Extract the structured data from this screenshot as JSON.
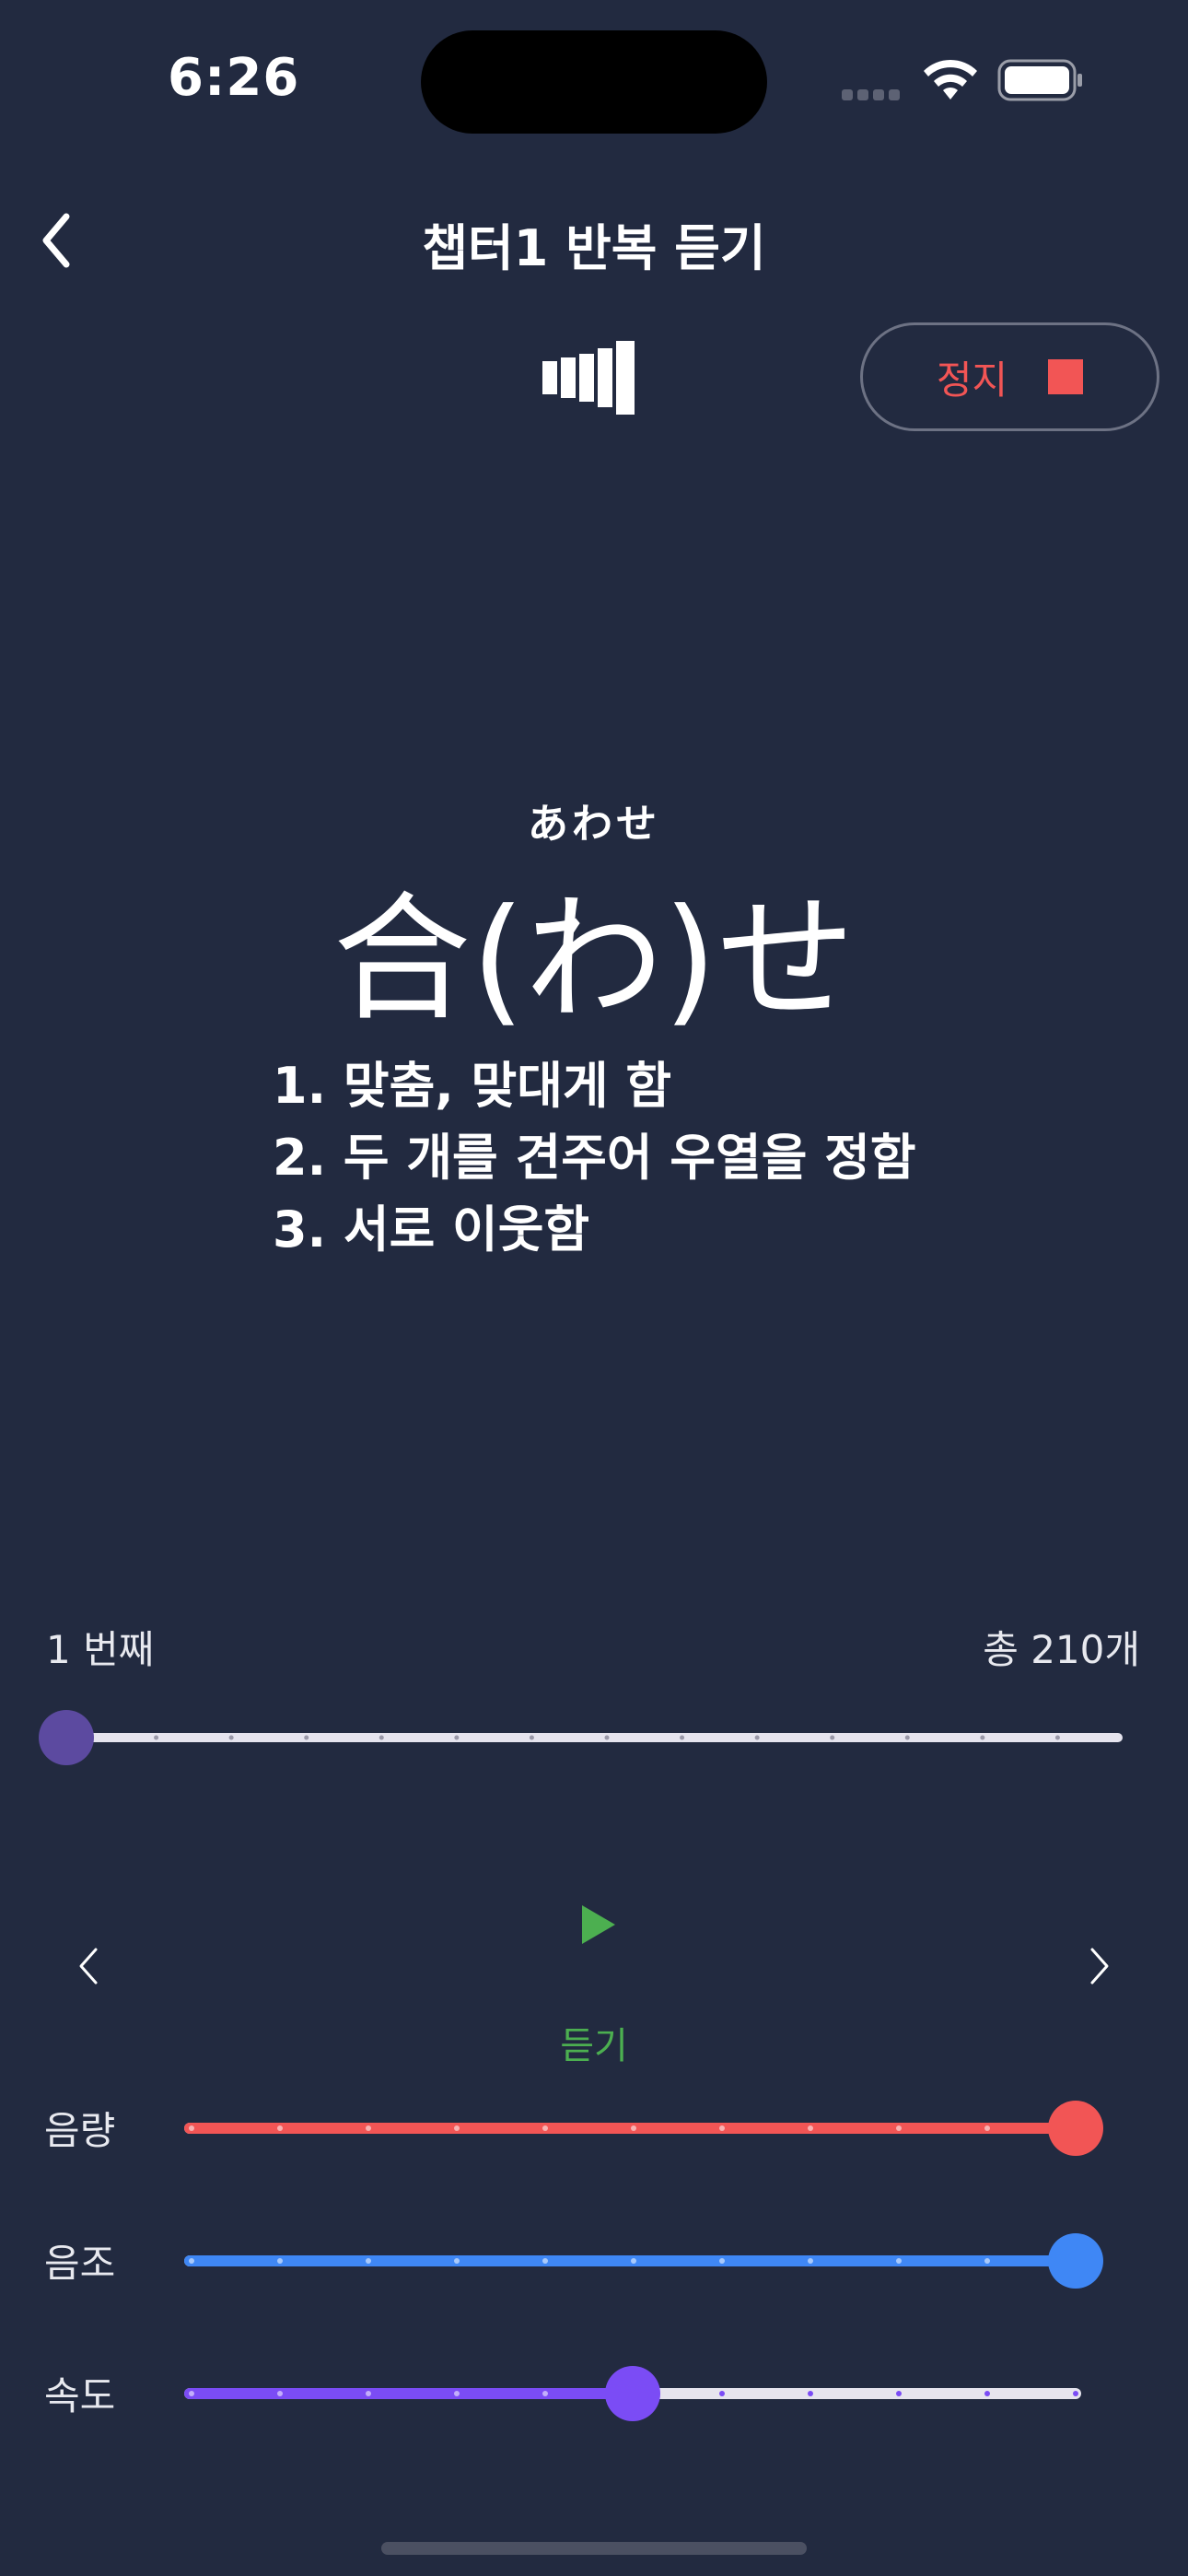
{
  "status_bar": {
    "time": "6:26",
    "wifi_icon": "wifi-icon",
    "battery_icon": "battery-icon"
  },
  "header": {
    "title": "챕터1 반복 듣기",
    "back_icon": "chevron-left-icon"
  },
  "controls": {
    "level_icon": "level-bars-icon",
    "stop_label": "정지",
    "stop_icon": "stop-square-icon"
  },
  "word": {
    "reading": "あわせ",
    "text": "合(わ)せ",
    "meanings": [
      "1. 맞춤, 맞대게 함",
      "2. 두 개를 견주어 우열을 정함",
      "3. 서로 이웃함"
    ]
  },
  "progress": {
    "current_label": "1 번째",
    "total_label": "총 210개",
    "current": 1,
    "total": 210
  },
  "player": {
    "play_label": "듣기",
    "play_icon": "play-icon",
    "prev_icon": "chevron-left-icon",
    "next_icon": "chevron-right-icon"
  },
  "sliders": [
    {
      "label": "음량",
      "value": 1.0,
      "color": "#f25555"
    },
    {
      "label": "음조",
      "value": 1.0,
      "color": "#3f87f5"
    },
    {
      "label": "속도",
      "value": 0.5,
      "color": "#7b4cf5"
    }
  ],
  "colors": {
    "background": "#222a40",
    "stop": "#f25555",
    "play": "#4caf50",
    "progress_thumb": "#5c4aa0",
    "track": "#e6e4ee"
  }
}
